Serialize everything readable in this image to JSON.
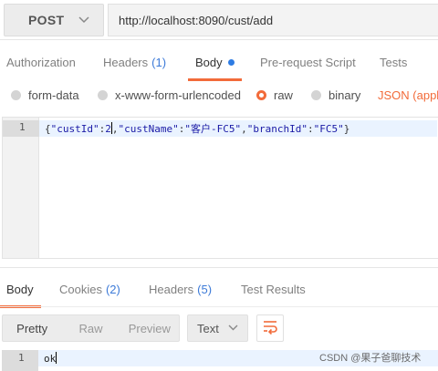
{
  "request": {
    "method": "POST",
    "url": "http://localhost:8090/cust/add"
  },
  "request_tabs": [
    {
      "label": "Authorization",
      "count": ""
    },
    {
      "label": "Headers",
      "count": "(1)"
    },
    {
      "label": "Body",
      "count": "",
      "active": true,
      "indicator": "blue-dot"
    },
    {
      "label": "Pre-request Script",
      "count": ""
    },
    {
      "label": "Tests",
      "count": ""
    }
  ],
  "body_types": {
    "form_data": "form-data",
    "urlencoded": "x-www-form-urlencoded",
    "raw": "raw",
    "binary": "binary",
    "selected": "raw",
    "content_type": "JSON (applic"
  },
  "editor": {
    "line_number": "1",
    "code": {
      "p1": "{",
      "k1": "\"custId\"",
      "c1": ":",
      "v1": "2",
      "s1": ",",
      "k2": "\"custName\"",
      "c2": ":",
      "v2": "\"客户-FC5\"",
      "s2": ",",
      "k3": "\"branchId\"",
      "c3": ":",
      "v3": "\"FC5\"",
      "p2": "}"
    }
  },
  "response_tabs": [
    {
      "label": "Body",
      "count": "",
      "active": true
    },
    {
      "label": "Cookies",
      "count": "(2)"
    },
    {
      "label": "Headers",
      "count": "(5)"
    },
    {
      "label": "Test Results",
      "count": ""
    }
  ],
  "response_toolbar": {
    "pretty": "Pretty",
    "raw": "Raw",
    "preview": "Preview",
    "format": "Text",
    "wrap_icon": "wrap-lines-icon"
  },
  "response_body": {
    "line_number": "1",
    "text": "ok"
  },
  "watermark": "CSDN @果子爸聊技术",
  "colors": {
    "accent": "#f26b3a",
    "link": "#3c7ad8",
    "dot": "#2e7ce3"
  }
}
